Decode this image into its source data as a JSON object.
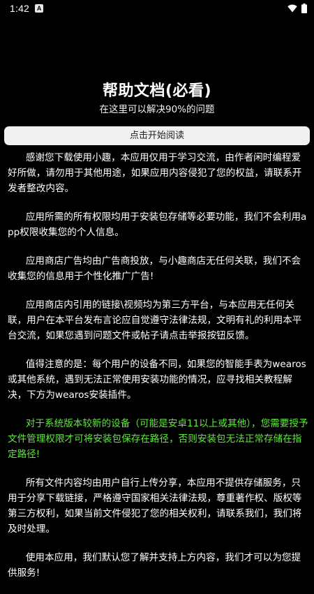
{
  "status_bar": {
    "time": "1:42",
    "notification_icon": "A",
    "icons": [
      "wifi-icon",
      "battery-icon"
    ]
  },
  "header": {
    "title": "帮助文档(必看)",
    "subtitle": "在这里可以解决90%的问题"
  },
  "start_button": {
    "label": "点击开始阅读"
  },
  "colors": {
    "background": "#000000",
    "text": "#ffffff",
    "highlight": "#5eea3c",
    "button_bg": "#f0f0f0"
  },
  "paragraphs": [
    "感谢您下载使用小趣，本应用仅用于学习交流，由作者闲时编程爱好所做，请勿用于其他用途，如果应用内容侵犯了您的权益，请联系开发者整改内容。",
    "应用所需的所有权限均用于安装包存储等必要功能，我们不会利用app权限收集您的个人信息。",
    "应用商店广告均由广告商投放，与小趣商店无任何关联，我们不会收集您的信息用于个性化推广广告!",
    "应用商店内引用的链接\\视频均为第三方平台，与本应用无任何关联，用户在本平台发布言论应自觉遵守法律法规，文明有礼的利用本平台交流，如果您遇到问题文件或帖子请点击举报按钮反馈。",
    "值得注意的是：每个用户的设备不同，如果您的智能手表为wearos或其他系统，遇到无法正常使用安装功能的情况，应寻找相关教程解决，下方为wearos安装插件。",
    "对于系统版本较新的设备（可能是安卓11以上或其他），您需要授予文件管理权限才可将安装包保存在路径，否则安装包无法正常存储在指定路径!",
    "所有文件内容均由用户自行上传分享，本应用不提供存储服务，只用于分享下载链接，严格遵守国家相关法律法规，尊重著作权、版权等第三方权利，如果当前文件侵犯了您的相关权利，请联系我们，我们将及时处理。",
    "使用本应用，我们默认您了解并支持上方内容，我们才可以为您提供服务!"
  ]
}
